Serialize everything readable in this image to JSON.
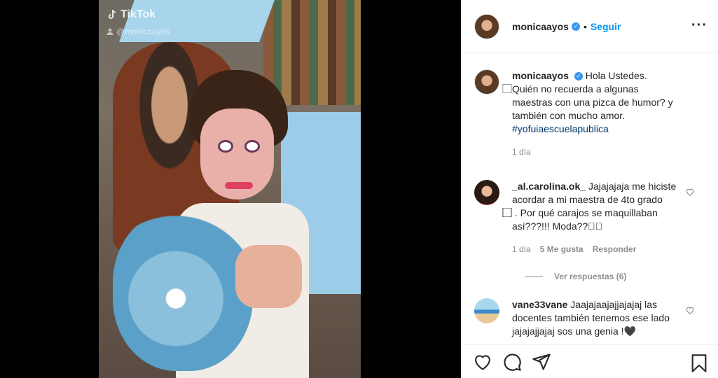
{
  "post": {
    "watermark": {
      "brand": "TikTok",
      "handle": "@monicaayos"
    }
  },
  "header": {
    "username": "monicaayos",
    "dot": "•",
    "follow_label": "Seguir",
    "more": "···"
  },
  "caption": {
    "username": "monicaayos",
    "text": "Hola Ustedes. ⃞Quién no recuerda a algunas maestras con una pizca de humor? y también con mucho amor. ",
    "hashtag": "#yofuiaescuelapublica",
    "time": "1 día"
  },
  "comments": [
    {
      "username": "_al.carolina.ok_",
      "text": "Jajajajaja me hiciste acordar a mi maestra de 4to grado ⃞⃞⃞⃞ . Por qué carajos se maquillaban así???!!! Moda??⃞⃞",
      "time": "1 día",
      "likes": "5 Me gusta",
      "reply": "Responder",
      "view_replies": "Ver respuestas (6)"
    },
    {
      "username": "vane33vane",
      "text": "Jaajajaajajjajajaj las docentes también tenemos ese lado jajajajjajaj sos una genia !🖤"
    }
  ],
  "colors": {
    "accent": "#0095f6",
    "verified": "#3897f0",
    "muted": "#8e8e8e",
    "hashtag": "#00376b"
  },
  "icons": [
    "heart-icon",
    "comment-icon",
    "share-icon",
    "bookmark-icon",
    "verified-icon",
    "more-icon"
  ]
}
